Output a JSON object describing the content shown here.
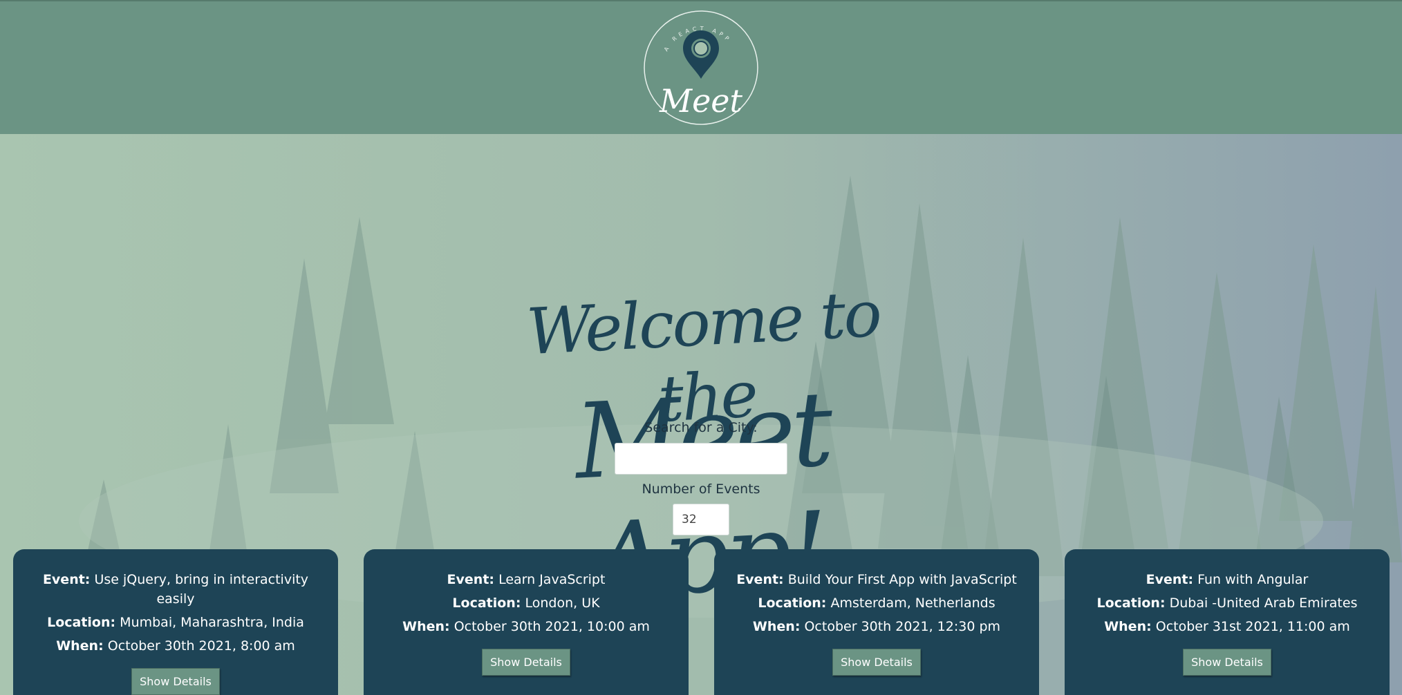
{
  "header": {
    "logo": {
      "ring_text": "A REACT APP",
      "wordmark": "Meet"
    }
  },
  "hero": {
    "welcome_line1": "Welcome to the",
    "welcome_line2": "Meet App!"
  },
  "search": {
    "label": "Search for a City:",
    "value": ""
  },
  "number_of_events": {
    "label": "Number of Events",
    "value": "32"
  },
  "labels": {
    "event": "Event:",
    "location": "Location:",
    "when": "When:"
  },
  "events": [
    {
      "event": "Use jQuery, bring in interactivity easily",
      "location": "Mumbai, Maharashtra, India",
      "when": "October 30th 2021, 8:00 am",
      "button": "Show Details"
    },
    {
      "event": "Learn JavaScript",
      "location": "London, UK",
      "when": "October 30th 2021, 10:00 am",
      "button": "Show Details"
    },
    {
      "event": "Build Your First App with JavaScript",
      "location": "Amsterdam, Netherlands",
      "when": "October 30th 2021, 12:30 pm",
      "button": "Show Details"
    },
    {
      "event": "Fun with Angular",
      "location": "Dubai -United Arab Emirates",
      "when": "October 31st 2021, 11:00 am",
      "button": "Show Details"
    }
  ],
  "colors": {
    "header_bg": "#6b9484",
    "card_bg": "#1e4456",
    "button_bg": "#6b9484",
    "title_color": "#1e4456"
  }
}
